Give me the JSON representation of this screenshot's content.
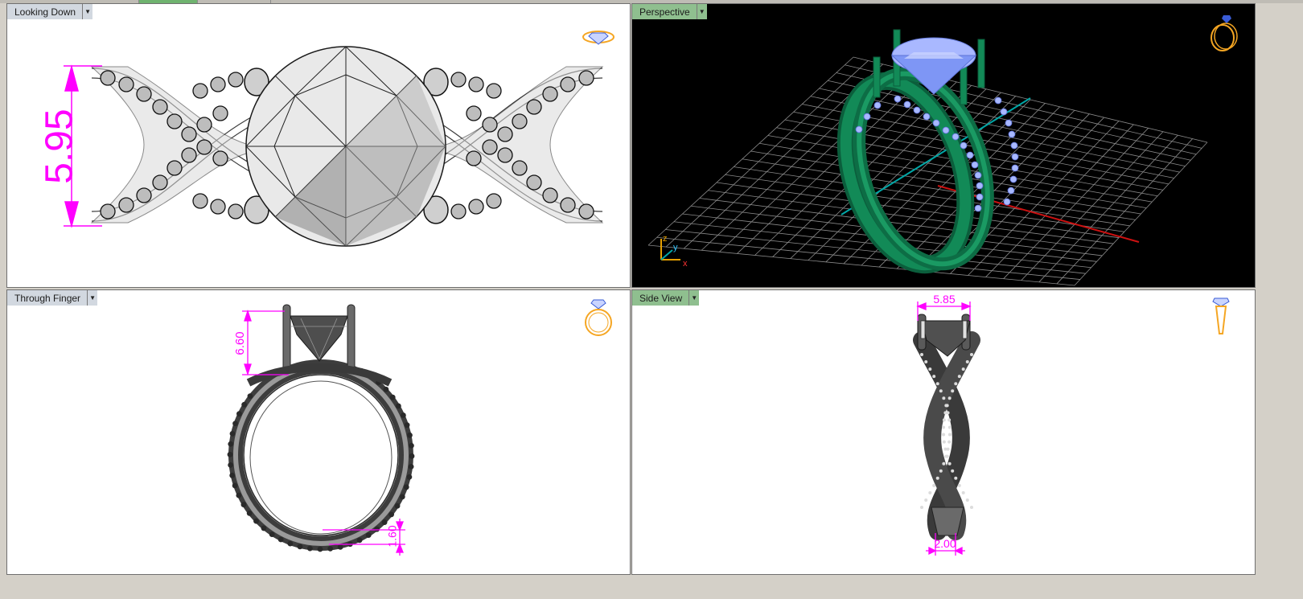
{
  "viewports": {
    "top_left": {
      "title": "Looking Down",
      "dimension": "5.95"
    },
    "top_right": {
      "title": "Perspective",
      "axis_z": "z",
      "axis_y": "y",
      "axis_x": "x"
    },
    "bottom_left": {
      "title": "Through Finger",
      "dimension_top": "6.60",
      "dimension_bottom": "1.60"
    },
    "bottom_right": {
      "title": "Side View",
      "dimension_top": "5.85",
      "dimension_bottom": "2.00"
    }
  },
  "icons": {
    "viewport_menu": "dropdown-arrow-icon",
    "top_view": "ring-top-view-icon",
    "perspective": "ring-perspective-icon",
    "front": "ring-front-icon",
    "side": "ring-side-icon"
  },
  "colors": {
    "dimension": "#ff00ff",
    "ring_metal_shaded": "#0e7a4f",
    "gem_shaded": "#8fa8ff",
    "grid_x_axis": "#cc0000",
    "grid_y_axis": "#00a0a0",
    "tab_active": "#8fbf8f",
    "tab_inactive": "#d2d8e0",
    "icon_orange": "#f5a623"
  }
}
